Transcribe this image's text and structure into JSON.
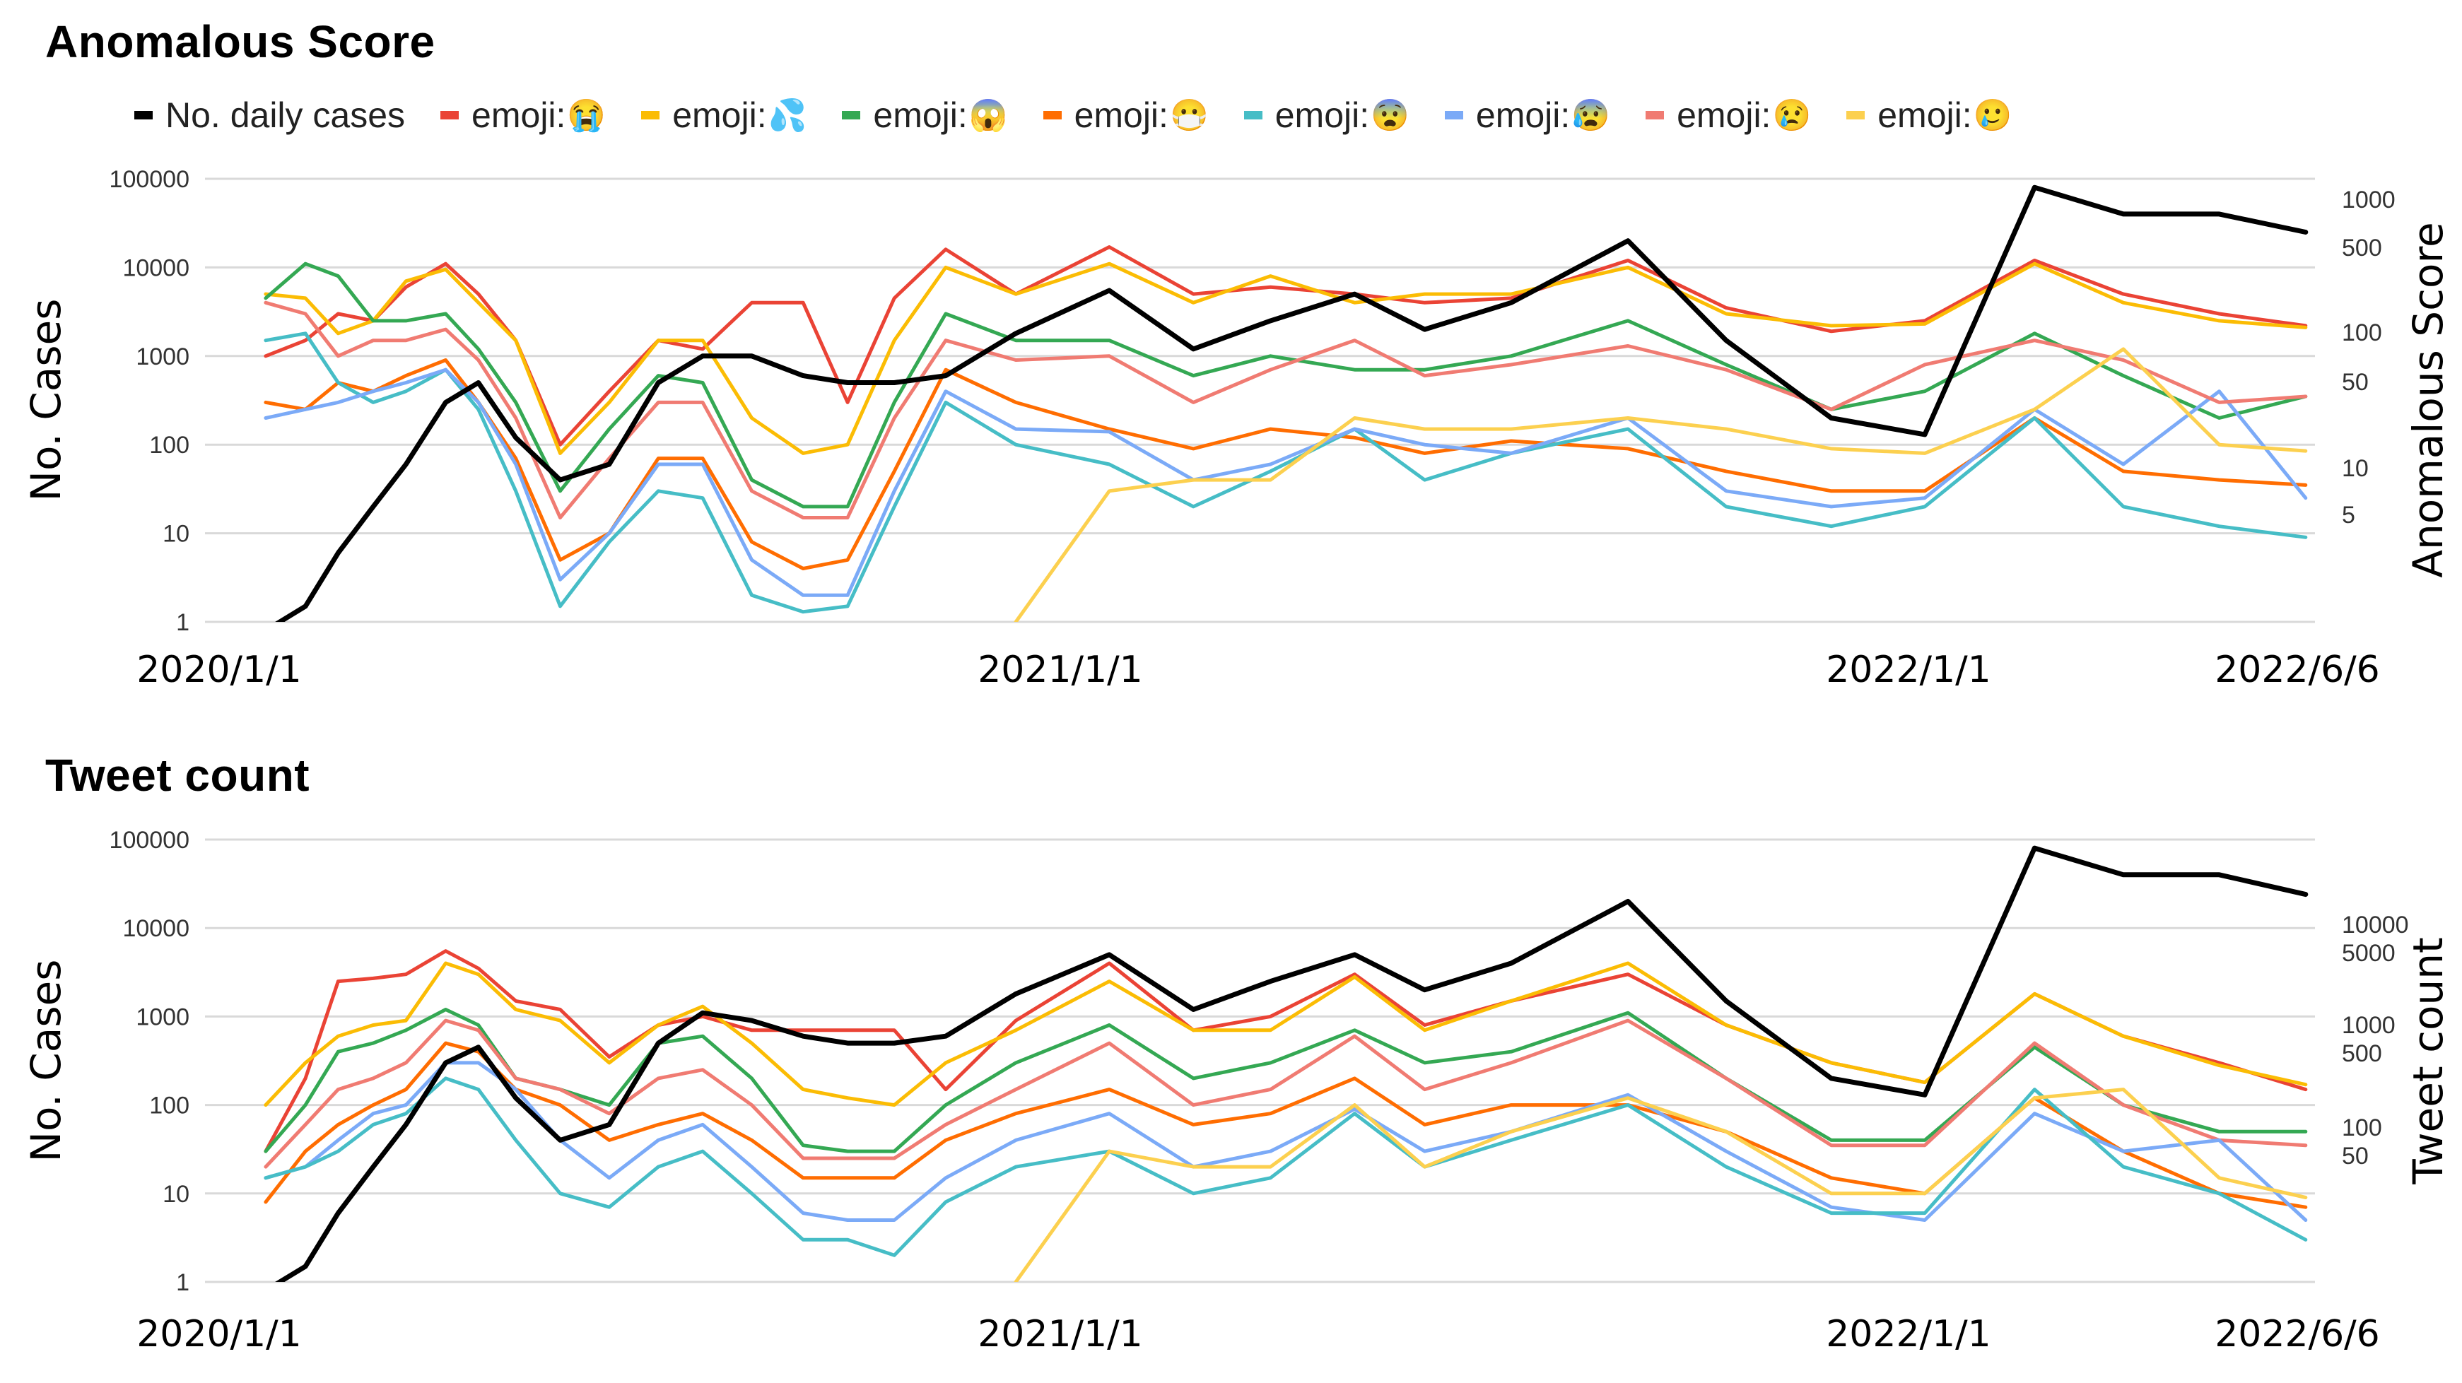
{
  "legend": [
    {
      "key": "cases",
      "label": "No. daily cases",
      "emoji": "",
      "color": "#000000"
    },
    {
      "key": "e1",
      "label": "emoji:",
      "emoji": "😭",
      "color": "#EA4335"
    },
    {
      "key": "e2",
      "label": "emoji:",
      "emoji": "💦",
      "color": "#FBBC04"
    },
    {
      "key": "e3",
      "label": "emoji:",
      "emoji": "😱",
      "color": "#34A853"
    },
    {
      "key": "e4",
      "label": "emoji:",
      "emoji": "😷",
      "color": "#FF6D01"
    },
    {
      "key": "e5",
      "label": "emoji:",
      "emoji": "😨",
      "color": "#46BDC6"
    },
    {
      "key": "e6",
      "label": "emoji:",
      "emoji": "😰",
      "color": "#7BAAF7"
    },
    {
      "key": "e7",
      "label": "emoji:",
      "emoji": "😢",
      "color": "#F07B72"
    },
    {
      "key": "e8",
      "label": "emoji:",
      "emoji": "🥲",
      "color": "#FCD04F"
    }
  ],
  "chart_data": [
    {
      "type": "line",
      "title": "Anomalous Score",
      "ylabel": "No. Cases",
      "y2label": "Anomalous Score",
      "yscale": "log",
      "ylim": [
        1,
        100000
      ],
      "yticks": [
        "100000",
        "10000",
        "1000",
        "100",
        "10",
        "1"
      ],
      "y2ticks": [
        "1000",
        "500",
        "100",
        "50",
        "10",
        "5"
      ],
      "xlabels": [
        "2020/1/1",
        "2021/1/1",
        "2022/1/1",
        "2022/6/6"
      ],
      "grid": true,
      "legend_position": "top",
      "x": [
        "2020-01-15",
        "2020-02-01",
        "2020-02-15",
        "2020-03-01",
        "2020-03-15",
        "2020-04-01",
        "2020-04-15",
        "2020-05-01",
        "2020-05-20",
        "2020-06-10",
        "2020-07-01",
        "2020-07-20",
        "2020-08-10",
        "2020-09-01",
        "2020-09-20",
        "2020-10-10",
        "2020-11-01",
        "2020-12-01",
        "2021-01-10",
        "2021-02-15",
        "2021-03-20",
        "2021-04-25",
        "2021-05-25",
        "2021-07-01",
        "2021-08-20",
        "2021-10-01",
        "2021-11-15",
        "2021-12-25",
        "2022-02-10",
        "2022-03-20",
        "2022-04-30",
        "2022-06-06"
      ],
      "series": [
        {
          "name": "No. daily cases",
          "values": [
            0.8,
            1.5,
            6,
            20,
            60,
            300,
            500,
            120,
            40,
            60,
            500,
            1000,
            1000,
            600,
            500,
            500,
            600,
            1800,
            5500,
            1200,
            2500,
            5000,
            2000,
            4000,
            20000,
            1500,
            200,
            130,
            80000,
            40000,
            40000,
            25000
          ]
        },
        {
          "name": "emoji:😭",
          "values": [
            1000,
            1500,
            3000,
            2500,
            6000,
            11000,
            5000,
            1500,
            100,
            400,
            1500,
            1200,
            4000,
            4000,
            300,
            4500,
            16000,
            5000,
            17000,
            5000,
            6000,
            5000,
            4000,
            4500,
            12000,
            3500,
            1900,
            2500,
            12000,
            5000,
            3000,
            2200
          ]
        },
        {
          "name": "emoji:💦",
          "values": [
            5000,
            4500,
            1800,
            2500,
            7000,
            9500,
            4000,
            1500,
            80,
            300,
            1500,
            1500,
            200,
            80,
            100,
            1500,
            10000,
            5000,
            11000,
            4000,
            8000,
            4000,
            5000,
            5000,
            10000,
            3000,
            2200,
            2300,
            11000,
            4000,
            2500,
            2100
          ]
        },
        {
          "name": "emoji:😱",
          "values": [
            4500,
            11000,
            8000,
            2500,
            2500,
            3000,
            1200,
            300,
            30,
            150,
            600,
            500,
            40,
            20,
            20,
            300,
            3000,
            1500,
            1500,
            600,
            1000,
            700,
            700,
            1000,
            2500,
            800,
            250,
            400,
            1800,
            600,
            200,
            350
          ]
        },
        {
          "name": "emoji:😷",
          "values": [
            300,
            250,
            500,
            400,
            600,
            900,
            300,
            70,
            5,
            10,
            70,
            70,
            8,
            4,
            5,
            50,
            700,
            300,
            150,
            90,
            150,
            120,
            80,
            110,
            90,
            50,
            30,
            30,
            200,
            50,
            40,
            35
          ]
        },
        {
          "name": "emoji:😨",
          "values": [
            1500,
            1800,
            500,
            300,
            400,
            700,
            250,
            30,
            1.5,
            8,
            30,
            25,
            2,
            1.3,
            1.5,
            20,
            300,
            100,
            60,
            20,
            50,
            150,
            40,
            80,
            150,
            20,
            12,
            20,
            200,
            20,
            12,
            9
          ]
        },
        {
          "name": "emoji:😰",
          "values": [
            200,
            250,
            300,
            400,
            500,
            700,
            300,
            60,
            3,
            10,
            60,
            60,
            5,
            2,
            2,
            30,
            400,
            150,
            140,
            40,
            60,
            150,
            100,
            80,
            200,
            30,
            20,
            25,
            250,
            60,
            400,
            25
          ]
        },
        {
          "name": "emoji:😢",
          "values": [
            4000,
            3000,
            1000,
            1500,
            1500,
            2000,
            900,
            200,
            15,
            70,
            300,
            300,
            30,
            15,
            15,
            200,
            1500,
            900,
            1000,
            300,
            700,
            1500,
            600,
            800,
            1300,
            700,
            250,
            800,
            1500,
            900,
            300,
            350
          ]
        },
        {
          "name": "emoji:🥲",
          "values": [
            null,
            null,
            null,
            null,
            null,
            null,
            null,
            null,
            null,
            null,
            null,
            null,
            null,
            null,
            null,
            null,
            null,
            1,
            30,
            40,
            40,
            200,
            150,
            150,
            200,
            150,
            90,
            80,
            250,
            1200,
            100,
            85
          ]
        }
      ]
    },
    {
      "type": "line",
      "title": "Tweet count",
      "ylabel": "No. Cases",
      "y2label": "Tweet count",
      "yscale": "log",
      "ylim": [
        1,
        100000
      ],
      "yticks": [
        "100000",
        "10000",
        "1000",
        "100",
        "10",
        "1"
      ],
      "y2ticks": [
        "10000",
        "5000",
        "1000",
        "500",
        "100",
        "50"
      ],
      "xlabels": [
        "2020/1/1",
        "2021/1/1",
        "2022/1/1",
        "2022/6/6"
      ],
      "grid": true,
      "legend_position": "top",
      "x": [
        "2020-01-15",
        "2020-02-01",
        "2020-02-15",
        "2020-03-01",
        "2020-03-15",
        "2020-04-01",
        "2020-04-15",
        "2020-05-01",
        "2020-05-20",
        "2020-06-10",
        "2020-07-01",
        "2020-07-20",
        "2020-08-10",
        "2020-09-01",
        "2020-09-20",
        "2020-10-10",
        "2020-11-01",
        "2020-12-01",
        "2021-01-10",
        "2021-02-15",
        "2021-03-20",
        "2021-04-25",
        "2021-05-25",
        "2021-07-01",
        "2021-08-20",
        "2021-10-01",
        "2021-11-15",
        "2021-12-25",
        "2022-02-10",
        "2022-03-20",
        "2022-04-30",
        "2022-06-06"
      ],
      "series": [
        {
          "name": "No. daily cases",
          "values": [
            0.8,
            1.5,
            6,
            20,
            60,
            300,
            450,
            120,
            40,
            60,
            500,
            1100,
            900,
            600,
            500,
            500,
            600,
            1800,
            5000,
            1200,
            2500,
            5000,
            2000,
            4000,
            20000,
            1500,
            200,
            130,
            80000,
            40000,
            40000,
            24000
          ]
        },
        {
          "name": "emoji:😭",
          "values": [
            30,
            200,
            2500,
            2700,
            3000,
            5500,
            3500,
            1500,
            1200,
            350,
            800,
            1000,
            700,
            700,
            700,
            700,
            150,
            900,
            4000,
            700,
            1000,
            3000,
            800,
            1500,
            3000,
            800,
            300,
            180,
            1800,
            600,
            300,
            150
          ]
        },
        {
          "name": "emoji:💦",
          "values": [
            100,
            300,
            600,
            800,
            900,
            4000,
            3000,
            1200,
            900,
            300,
            800,
            1300,
            500,
            150,
            120,
            100,
            300,
            700,
            2500,
            700,
            700,
            2800,
            700,
            1500,
            4000,
            800,
            300,
            180,
            1800,
            600,
            280,
            170
          ]
        },
        {
          "name": "emoji:😱",
          "values": [
            30,
            100,
            400,
            500,
            700,
            1200,
            800,
            200,
            150,
            100,
            500,
            600,
            200,
            35,
            30,
            30,
            100,
            300,
            800,
            200,
            300,
            700,
            300,
            400,
            1100,
            200,
            40,
            40,
            450,
            100,
            50,
            50
          ]
        },
        {
          "name": "emoji:😢",
          "values": [
            20,
            60,
            150,
            200,
            300,
            900,
            700,
            200,
            150,
            80,
            200,
            250,
            100,
            25,
            25,
            25,
            60,
            150,
            500,
            100,
            150,
            600,
            150,
            300,
            900,
            200,
            35,
            35,
            500,
            100,
            40,
            35
          ]
        },
        {
          "name": "emoji:😷",
          "values": [
            8,
            30,
            60,
            100,
            150,
            500,
            400,
            150,
            100,
            40,
            60,
            80,
            40,
            15,
            15,
            15,
            40,
            80,
            150,
            60,
            80,
            200,
            60,
            100,
            100,
            50,
            15,
            10,
            120,
            30,
            10,
            7
          ]
        },
        {
          "name": "emoji:😰",
          "values": [
            15,
            20,
            40,
            80,
            100,
            300,
            300,
            150,
            40,
            15,
            40,
            60,
            20,
            6,
            5,
            5,
            15,
            40,
            80,
            20,
            30,
            90,
            30,
            50,
            130,
            30,
            7,
            5,
            80,
            30,
            40,
            5
          ]
        },
        {
          "name": "emoji:😨",
          "values": [
            15,
            20,
            30,
            60,
            80,
            200,
            150,
            40,
            10,
            7,
            20,
            30,
            10,
            3,
            3,
            2,
            8,
            20,
            30,
            10,
            15,
            80,
            20,
            40,
            100,
            20,
            6,
            6,
            150,
            20,
            10,
            3
          ]
        },
        {
          "name": "emoji:🥲",
          "values": [
            null,
            null,
            null,
            null,
            null,
            null,
            null,
            null,
            null,
            null,
            null,
            null,
            null,
            null,
            null,
            null,
            null,
            1,
            30,
            20,
            20,
            100,
            20,
            50,
            120,
            50,
            10,
            10,
            120,
            150,
            15,
            9
          ]
        }
      ]
    }
  ]
}
